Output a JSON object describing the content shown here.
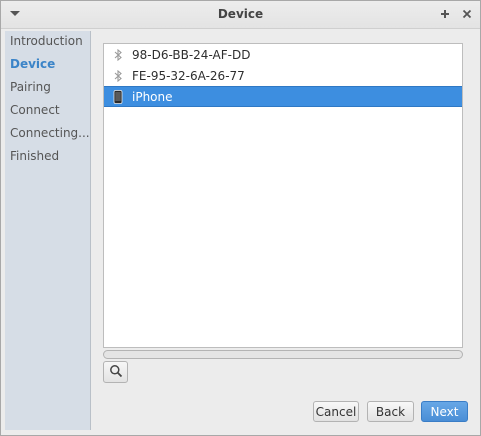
{
  "window": {
    "title": "Device"
  },
  "sidebar": {
    "items": [
      {
        "label": "Introduction"
      },
      {
        "label": "Device"
      },
      {
        "label": "Pairing"
      },
      {
        "label": "Connect"
      },
      {
        "label": "Connecting..."
      },
      {
        "label": "Finished"
      }
    ],
    "active_index": 1
  },
  "devices": [
    {
      "label": "98-D6-BB-24-AF-DD",
      "icon": "bluetooth-icon"
    },
    {
      "label": "FE-95-32-6A-26-77",
      "icon": "bluetooth-icon"
    },
    {
      "label": "iPhone",
      "icon": "phone-icon",
      "selected": true
    }
  ],
  "buttons": {
    "cancel": "Cancel",
    "back": "Back",
    "next": "Next"
  },
  "colors": {
    "accent": "#3d8ee0",
    "sidebar_active": "#3b84c8",
    "sidebar_bg": "#d6dde6"
  }
}
